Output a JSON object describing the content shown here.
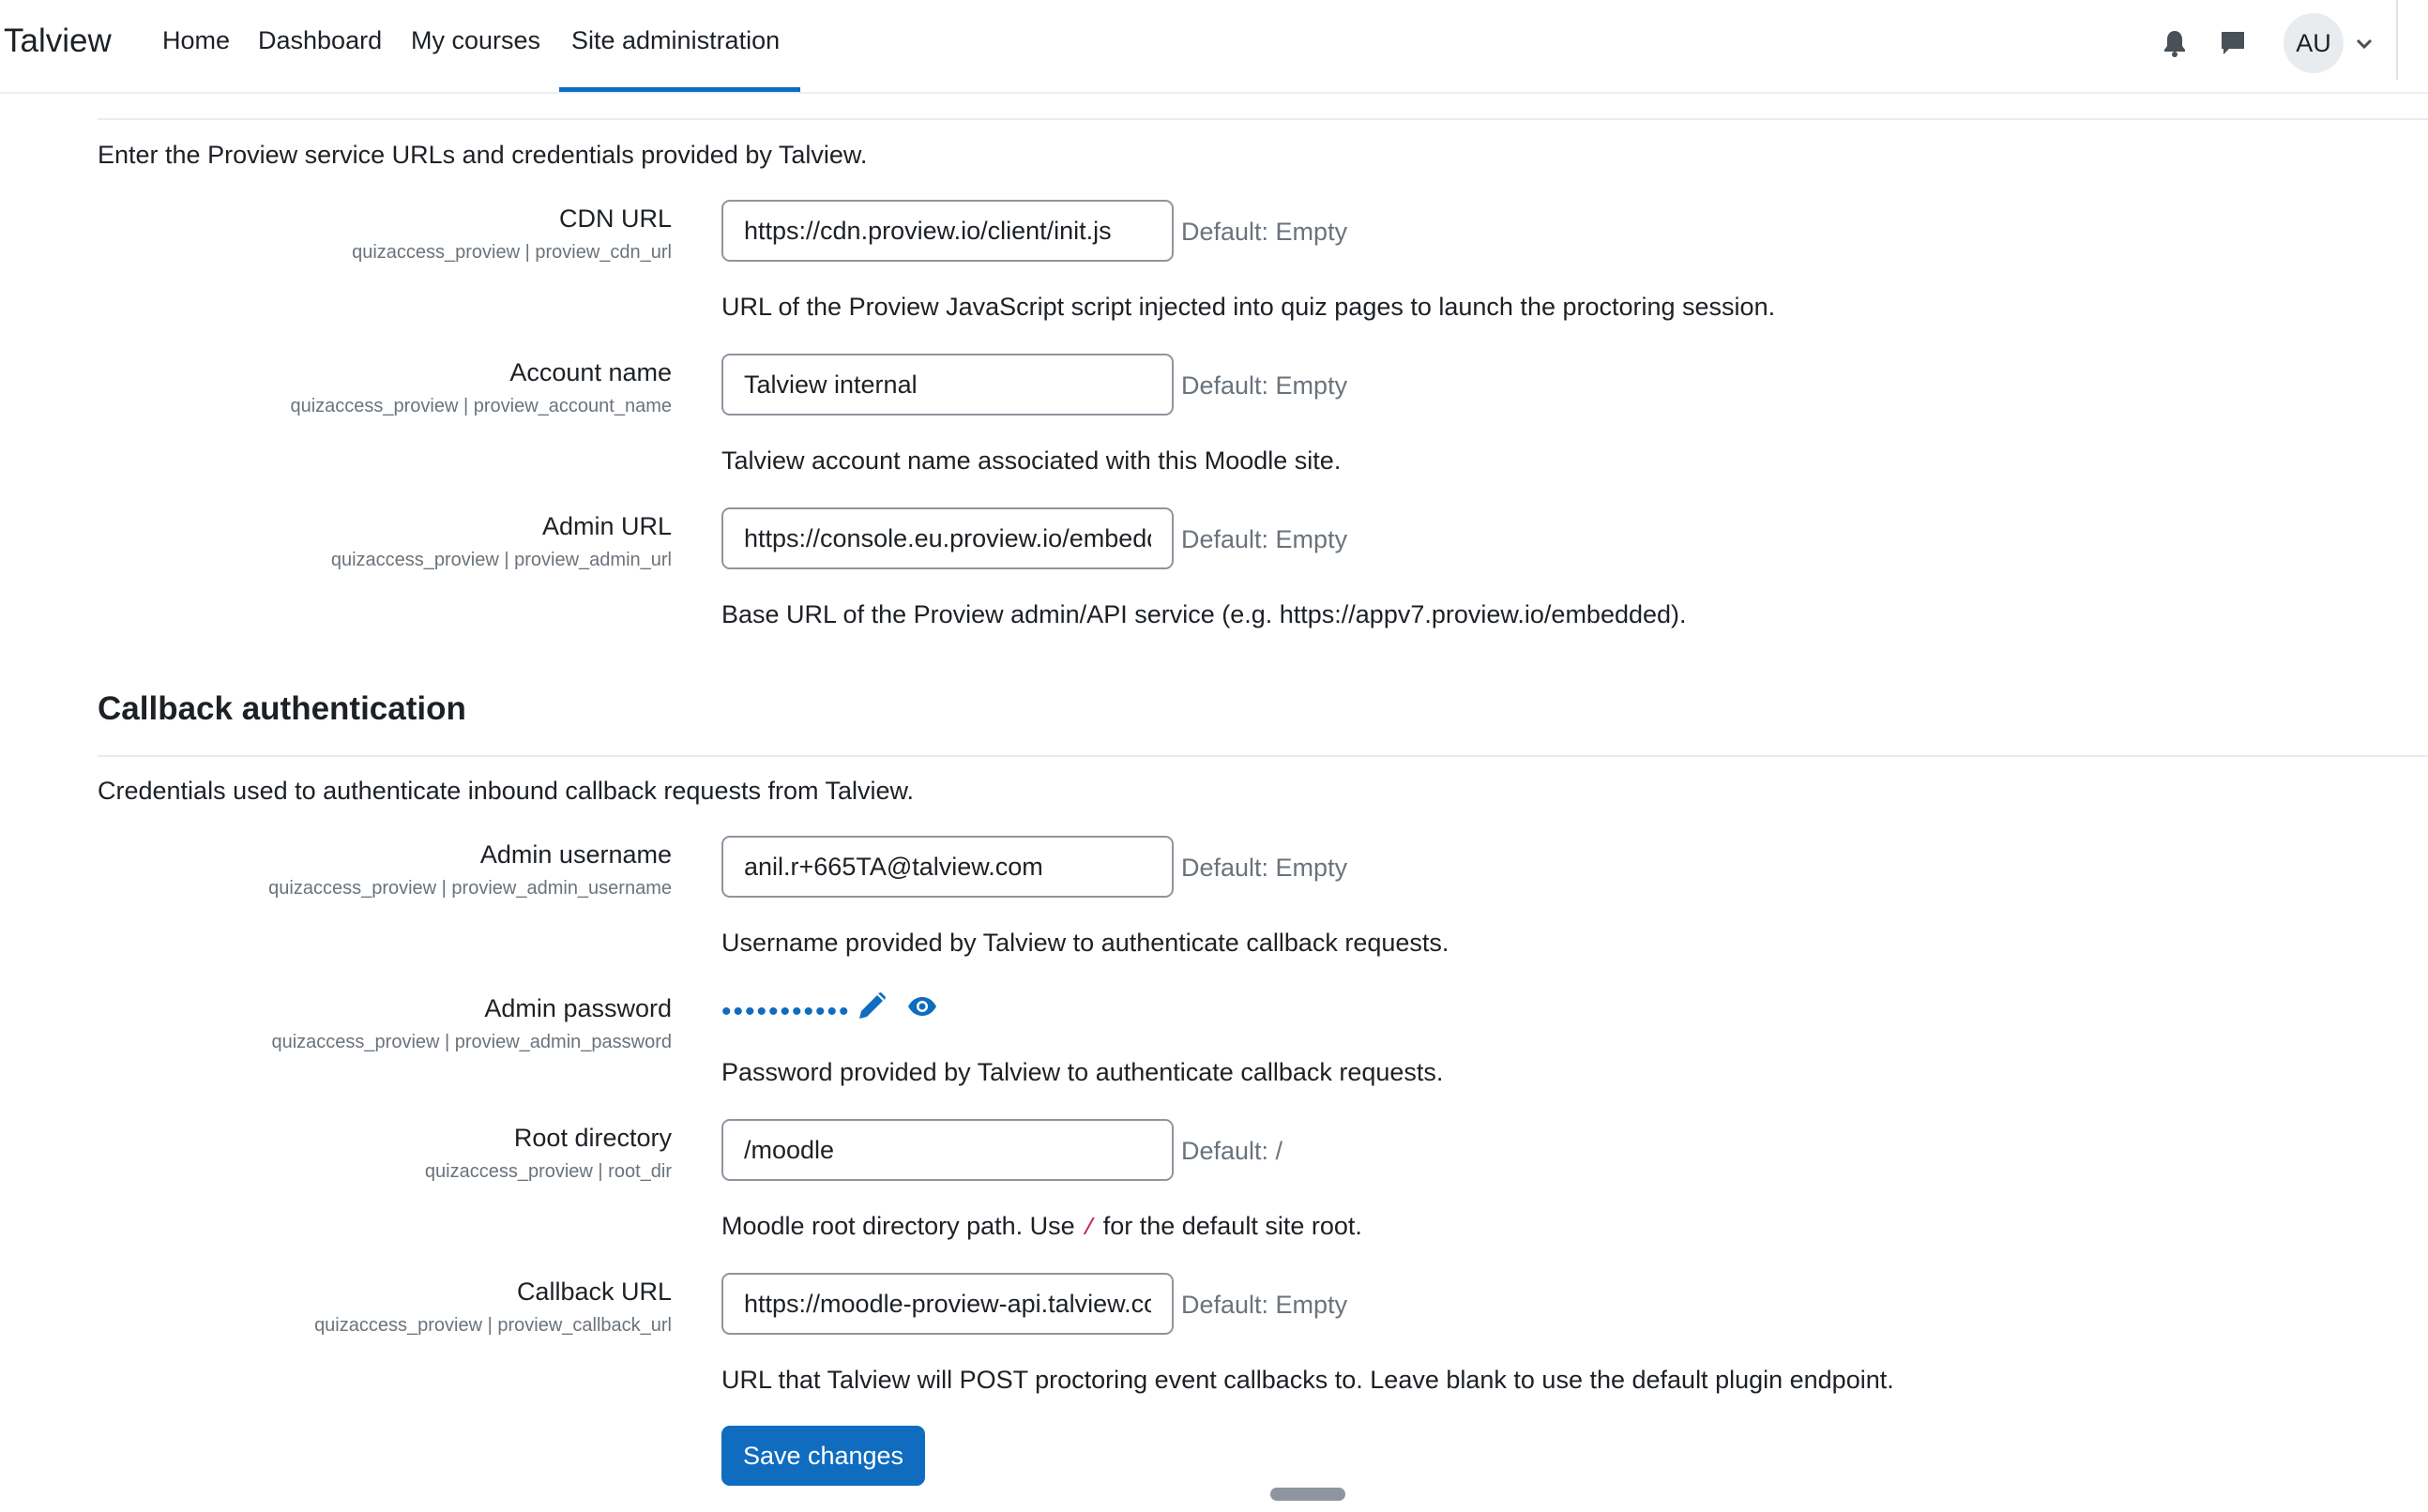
{
  "navbar": {
    "brand": "Talview",
    "links": [
      "Home",
      "Dashboard",
      "My courses",
      "Site administration"
    ],
    "active_link": "Site administration",
    "avatar_initials": "AU"
  },
  "proview_section": {
    "description": "Enter the Proview service URLs and credentials provided by Talview."
  },
  "settings": [
    {
      "label": "CDN URL",
      "sublabel": "quizaccess_proview | proview_cdn_url",
      "value": "https://cdn.proview.io/client/init.js",
      "default": "Default: Empty",
      "help": "URL of the Proview JavaScript script injected into quiz pages to launch the proctoring session."
    },
    {
      "label": "Account name",
      "sublabel": "quizaccess_proview | proview_account_name",
      "value": "Talview internal",
      "default": "Default: Empty",
      "help": "Talview account name associated with this Moodle site."
    },
    {
      "label": "Admin URL",
      "sublabel": "quizaccess_proview | proview_admin_url",
      "value": "https://console.eu.proview.io/embedded",
      "default": "Default: Empty",
      "help": "Base URL of the Proview admin/API service (e.g. https://appv7.proview.io/embedded)."
    }
  ],
  "callback_section": {
    "heading": "Callback authentication",
    "description": "Credentials used to authenticate inbound callback requests from Talview."
  },
  "callback_settings": {
    "admin_username": {
      "label": "Admin username",
      "sublabel": "quizaccess_proview | proview_admin_username",
      "value": "anil.r+665TA@talview.com",
      "default": "Default: Empty",
      "help": "Username provided by Talview to authenticate callback requests."
    },
    "admin_password": {
      "label": "Admin password",
      "sublabel": "quizaccess_proview | proview_admin_password",
      "masked": "•••••••••••",
      "help": "Password provided by Talview to authenticate callback requests."
    },
    "root_directory": {
      "label": "Root directory",
      "sublabel": "quizaccess_proview | root_dir",
      "value": "/moodle",
      "default": "Default: /",
      "help_before": "Moodle root directory path. Use ",
      "help_code": "/",
      "help_after": " for the default site root."
    },
    "callback_url": {
      "label": "Callback URL",
      "sublabel": "quizaccess_proview | proview_callback_url",
      "value": "https://moodle-proview-api.talview.com",
      "default": "Default: Empty",
      "help": "URL that Talview will POST proctoring event callbacks to. Leave blank to use the default plugin endpoint."
    }
  },
  "actions": {
    "save_label": "Save changes"
  },
  "colors": {
    "accent": "#0f6cbf",
    "muted_text": "#6a737b",
    "code_text": "#c7254e"
  }
}
